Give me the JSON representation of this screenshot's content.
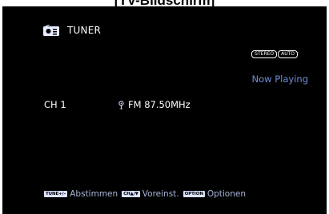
{
  "caption": "[TV-Bildschirm]",
  "screen": {
    "source_icon": "radio-icon",
    "source_name": "TUNER",
    "badges": [
      "STEREO",
      "AUTO"
    ],
    "status": "Now Playing",
    "channel": "CH 1",
    "antenna_icon": "antenna-icon",
    "frequency": "FM 87.50MHz",
    "hints": [
      {
        "key": "TUNE+/–",
        "label": "Abstimmen"
      },
      {
        "key": "CH▲/▼",
        "label": "Voreinst."
      },
      {
        "key": "OPTION",
        "label": "Optionen"
      }
    ]
  },
  "colors": {
    "screen_background": "#000000",
    "status_blue": "#6f8fd9",
    "text": "#ffffff",
    "hint_text": "#a9b6d8"
  }
}
